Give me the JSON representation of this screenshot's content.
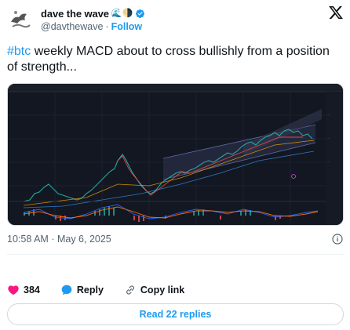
{
  "author": {
    "display_name": "dave the wave",
    "emoji": "🌊🌗",
    "handle": "@davthewave",
    "separator": "·",
    "follow_label": "Follow"
  },
  "tweet": {
    "hashtag": "#btc",
    "text": " weekly MACD about to cross bullishly from a position of strength..."
  },
  "meta": {
    "time": "10:58 AM",
    "separator": "·",
    "date": "May 6, 2025"
  },
  "actions": {
    "like_count": "384",
    "reply_label": "Reply",
    "copy_link_label": "Copy link"
  },
  "replies_button": {
    "label": "Read 22 replies"
  },
  "colors": {
    "accent": "#1d9bf0",
    "like": "#f91880",
    "chart_background": "#131722"
  },
  "icons": {
    "platform": "x-logo-icon",
    "verified": "verified-badge-icon",
    "info": "info-icon",
    "like": "heart-icon",
    "reply": "reply-bubble-icon",
    "copy_link": "link-icon"
  }
}
